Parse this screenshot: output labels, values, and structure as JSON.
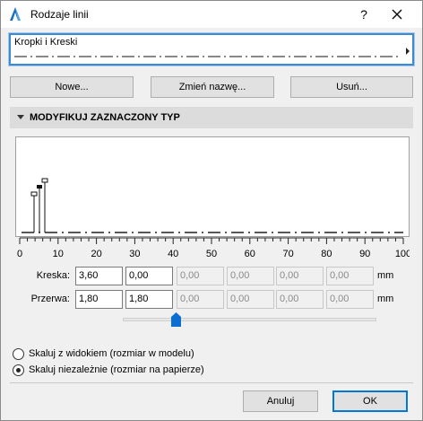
{
  "window": {
    "title": "Rodzaje linii",
    "help_label": "?",
    "icon": "app-icon",
    "close_icon": "close-icon"
  },
  "line_type": {
    "selected": "Kropki i Kreski"
  },
  "buttons": {
    "new": "Nowe...",
    "rename": "Zmień nazwę...",
    "delete": "Usuń..."
  },
  "section": {
    "title": "MODYFIKUJ ZAZNACZONY TYP"
  },
  "ruler": {
    "ticks": [
      "0",
      "10",
      "20",
      "30",
      "40",
      "50",
      "60",
      "70",
      "80",
      "90",
      "100"
    ]
  },
  "dash": {
    "label": "Kreska:",
    "values": [
      "3,60",
      "0,00",
      "0,00",
      "0,00",
      "0,00",
      "0,00"
    ],
    "unit": "mm"
  },
  "gap": {
    "label": "Przerwa:",
    "values": [
      "1,80",
      "1,80",
      "0,00",
      "0,00",
      "0,00",
      "0,00"
    ],
    "unit": "mm"
  },
  "scale_options": [
    {
      "label": "Skaluj z widokiem (rozmiar w modelu)",
      "checked": false
    },
    {
      "label": "Skaluj niezależnie (rozmiar na papierze)",
      "checked": true
    }
  ],
  "footer": {
    "cancel": "Anuluj",
    "ok": "OK"
  }
}
